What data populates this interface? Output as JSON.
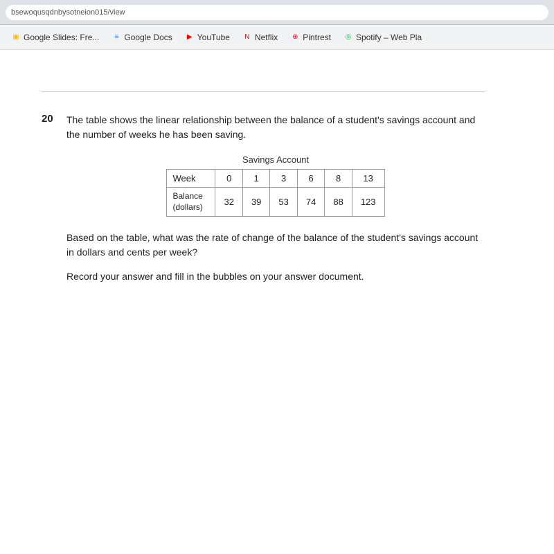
{
  "browser": {
    "address": "bsewoqusqdnbysotneion015/view"
  },
  "bookmarks": [
    {
      "id": "slides",
      "label": "Google Slides: Fre...",
      "icon": "▣",
      "iconClass": "icon-slides"
    },
    {
      "id": "docs",
      "label": "Google Docs",
      "icon": "≡",
      "iconClass": "icon-docs"
    },
    {
      "id": "youtube",
      "label": "YouTube",
      "icon": "▶",
      "iconClass": "icon-youtube"
    },
    {
      "id": "netflix",
      "label": "Netflix",
      "icon": "N",
      "iconClass": "icon-netflix"
    },
    {
      "id": "pinterest",
      "label": "Pintrest",
      "icon": "⊕",
      "iconClass": "icon-pinterest"
    },
    {
      "id": "spotify",
      "label": "Spotify – Web Pla",
      "icon": "◎",
      "iconClass": "icon-spotify"
    }
  ],
  "question": {
    "number": "20",
    "text": "The table shows the linear relationship between the balance of a student's savings account and the number of weeks he has been saving.",
    "table": {
      "title": "Savings Account",
      "headers": [
        "Week",
        "0",
        "1",
        "3",
        "6",
        "8",
        "13"
      ],
      "row_label": "Balance\n(dollars)",
      "values": [
        "32",
        "39",
        "53",
        "74",
        "88",
        "123"
      ]
    },
    "follow_up": "Based on the table, what was the rate of change of the balance of the student's savings account in dollars and cents per week?",
    "instruction": "Record your answer and fill in the bubbles on your answer document."
  }
}
